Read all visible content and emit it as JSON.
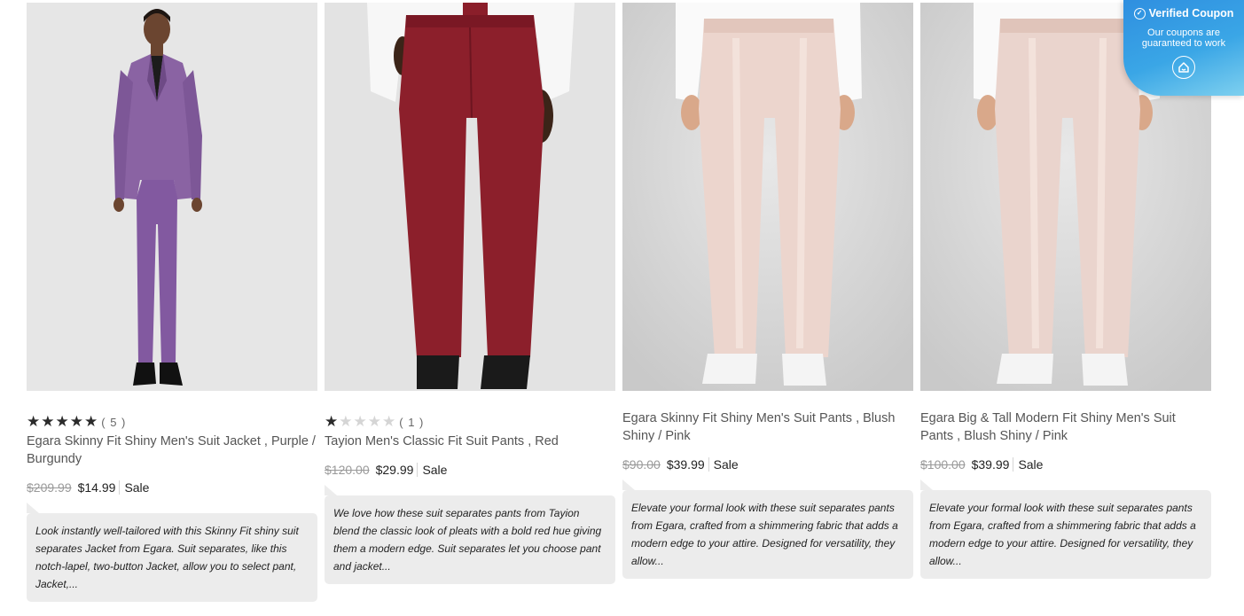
{
  "coupon": {
    "title": "Verified Coupon",
    "subtitle": "Our coupons are guaranteed to work",
    "icon": "check-circle-icon"
  },
  "products": [
    {
      "rating": {
        "value": 5,
        "max": 5,
        "count": "( 5 )"
      },
      "title": "Egara Skinny Fit Shiny Men's Suit Jacket , Purple / Burgundy",
      "was_price": "$209.99",
      "price": "$14.99",
      "sale": "Sale",
      "description": "Look instantly well-tailored with this Skinny Fit shiny suit separates Jacket from Egara. Suit separates, like this notch-lapel, two-button Jacket, allow you to select pant, Jacket,..."
    },
    {
      "rating": {
        "value": 1,
        "max": 5,
        "count": "( 1 )"
      },
      "title": "Tayion Men's Classic Fit Suit Pants , Red",
      "was_price": "$120.00",
      "price": "$29.99",
      "sale": "Sale",
      "description": "We love how these suit separates pants from Tayion blend the classic look of pleats with a bold red hue giving them a modern edge. Suit separates let you choose pant and jacket..."
    },
    {
      "title": "Egara Skinny Fit Shiny Men's Suit Pants , Blush Shiny / Pink",
      "was_price": "$90.00",
      "price": "$39.99",
      "sale": "Sale",
      "description": "Elevate your formal look with these suit separates pants from Egara, crafted from a shimmering fabric that adds a modern edge to your attire. Designed for versatility, they allow..."
    },
    {
      "title": "Egara Big & Tall Modern Fit Shiny Men's Suit Pants , Blush Shiny / Pink",
      "was_price": "$100.00",
      "price": "$39.99",
      "sale": "Sale",
      "description": "Elevate your formal look with these suit separates pants from Egara, crafted from a shimmering fabric that adds a modern edge to your attire. Designed for versatility, they allow..."
    }
  ]
}
